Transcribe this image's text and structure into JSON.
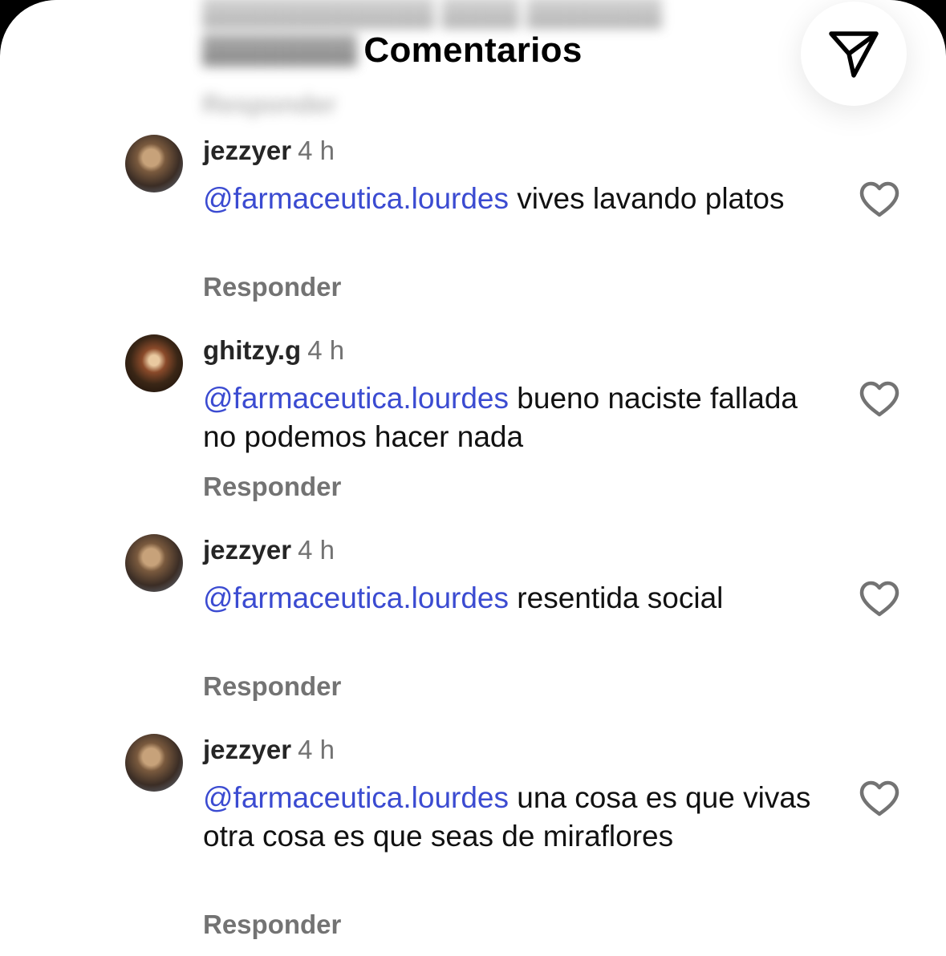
{
  "header": {
    "title": "Comentarios"
  },
  "previous_comment": {
    "text": "",
    "reply_label": "Responder"
  },
  "comments": [
    {
      "username": "jezzyer",
      "time": "4 h",
      "mention": "@farmaceutica.lourdes",
      "text": " vives  lavando platos",
      "reply_label": "Responder"
    },
    {
      "username": "ghitzy.g",
      "time": "4 h",
      "mention": "@farmaceutica.lourdes",
      "text": " bueno naciste fallada no podemos hacer nada",
      "reply_label": "Responder"
    },
    {
      "username": "jezzyer",
      "time": "4 h",
      "mention": "@farmaceutica.lourdes",
      "text": " resentida social",
      "reply_label": "Responder"
    },
    {
      "username": "jezzyer",
      "time": "4 h",
      "mention": "@farmaceutica.lourdes",
      "text": " una cosa es que vivas otra cosa es que seas de miraflores",
      "reply_label": "Responder"
    }
  ],
  "icons": {
    "share": "paper-plane-icon",
    "like": "heart-outline-icon"
  },
  "colors": {
    "mention": "#3b4bd1",
    "secondary_text": "#737373",
    "primary_text": "#111111"
  }
}
